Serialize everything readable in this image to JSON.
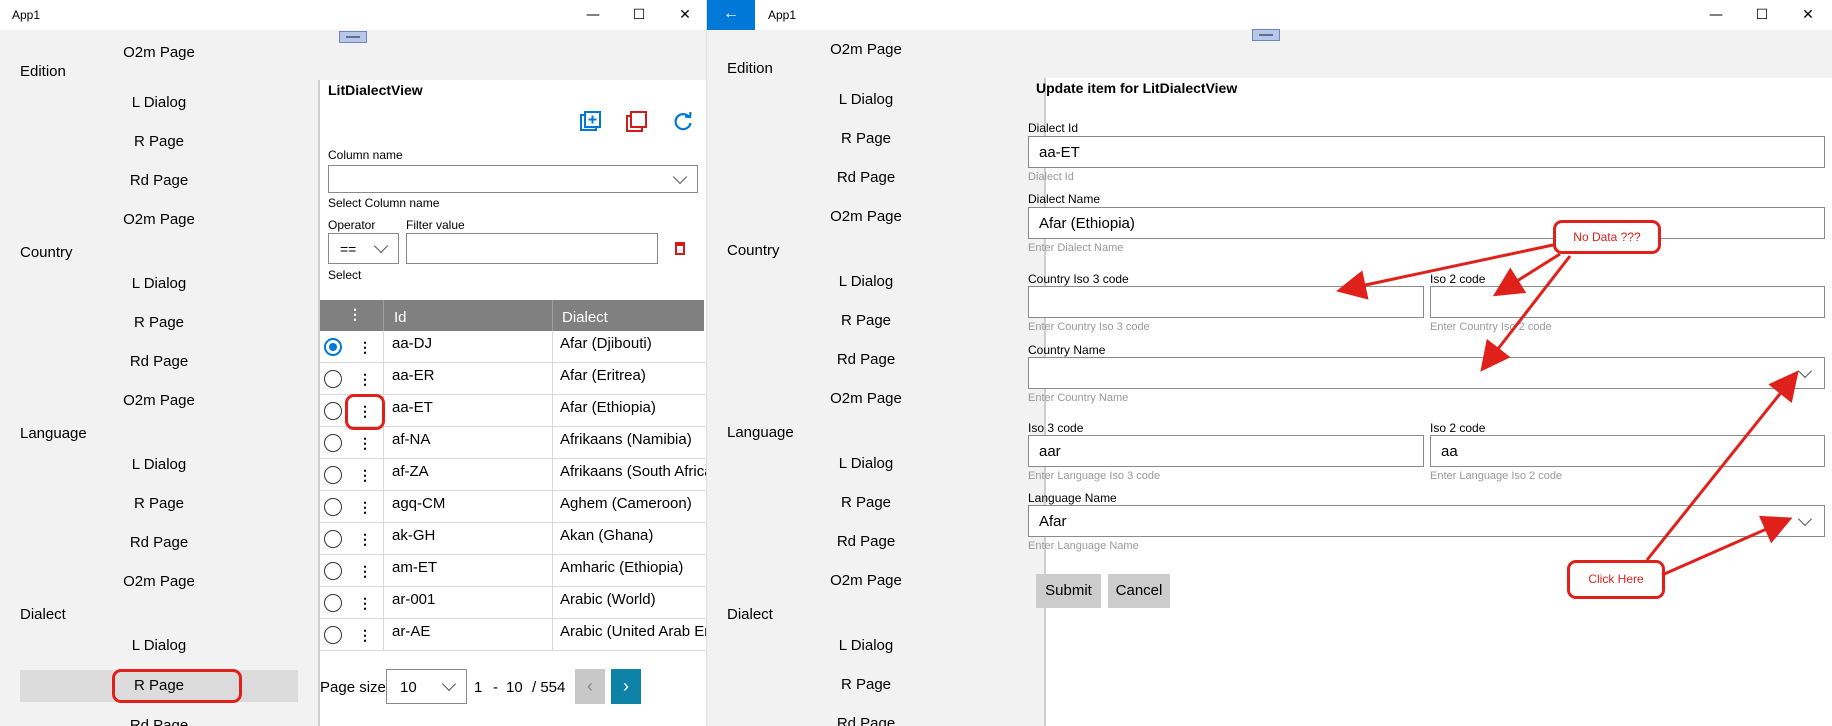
{
  "left_window": {
    "title": "App1",
    "controls": {
      "minimize": "—",
      "maximize": "☐",
      "close": "✕"
    },
    "nav": {
      "top_item": "O2m Page",
      "sections": [
        {
          "label": "Edition",
          "items": [
            "L Dialog",
            "R Page",
            "Rd Page",
            "O2m Page"
          ]
        },
        {
          "label": "Country",
          "items": [
            "L Dialog",
            "R Page",
            "Rd Page",
            "O2m Page"
          ]
        },
        {
          "label": "Language",
          "items": [
            "L Dialog",
            "R Page",
            "Rd Page",
            "O2m Page"
          ]
        },
        {
          "label": "Dialect",
          "items": [
            "L Dialog",
            "R Page",
            "Rd Page"
          ]
        }
      ],
      "selected": "Dialect / R Page"
    },
    "view": {
      "title": "LitDialectView",
      "toolbar_icons": [
        "add-item-icon",
        "copy-item-icon",
        "refresh-icon"
      ],
      "column_name_label": "Column name",
      "column_name_value": "",
      "column_name_hint": "Select Column name",
      "operator_label": "Operator",
      "operator_value": "==",
      "filter_label": "Filter value",
      "filter_value": "",
      "select_hint": "Select",
      "grid": {
        "headers": [
          "Id",
          "Dialect"
        ],
        "rows": [
          {
            "id": "aa-DJ",
            "dialect": "Afar (Djibouti)",
            "selected": true
          },
          {
            "id": "aa-ER",
            "dialect": "Afar (Eritrea)",
            "selected": false
          },
          {
            "id": "aa-ET",
            "dialect": "Afar (Ethiopia)",
            "selected": false
          },
          {
            "id": "af-NA",
            "dialect": "Afrikaans (Namibia)",
            "selected": false
          },
          {
            "id": "af-ZA",
            "dialect": "Afrikaans (South Africa)",
            "selected": false
          },
          {
            "id": "agq-CM",
            "dialect": "Aghem (Cameroon)",
            "selected": false
          },
          {
            "id": "ak-GH",
            "dialect": "Akan (Ghana)",
            "selected": false
          },
          {
            "id": "am-ET",
            "dialect": "Amharic (Ethiopia)",
            "selected": false
          },
          {
            "id": "ar-001",
            "dialect": "Arabic (World)",
            "selected": false
          },
          {
            "id": "ar-AE",
            "dialect": "Arabic (United Arab Emirates)",
            "selected": false
          }
        ]
      },
      "pager": {
        "size_label": "Page size",
        "size_value": "10",
        "from": "1",
        "dash": "-",
        "to": "10",
        "of": "/ 554",
        "prev": "‹",
        "next": "›"
      }
    }
  },
  "right_window": {
    "title": "App1",
    "back": "←",
    "controls": {
      "minimize": "—",
      "maximize": "☐",
      "close": "✕"
    },
    "nav": {
      "top_item": "O2m Page",
      "sections": [
        {
          "label": "Edition",
          "items": [
            "L Dialog",
            "R Page",
            "Rd Page",
            "O2m Page"
          ]
        },
        {
          "label": "Country",
          "items": [
            "L Dialog",
            "R Page",
            "Rd Page",
            "O2m Page"
          ]
        },
        {
          "label": "Language",
          "items": [
            "L Dialog",
            "R Page",
            "Rd Page",
            "O2m Page"
          ]
        },
        {
          "label": "Dialect",
          "items": [
            "L Dialog",
            "R Page",
            "Rd Page"
          ]
        }
      ]
    },
    "form": {
      "title": "Update item for LitDialectView",
      "dialect_id": {
        "label": "Dialect Id",
        "value": "aa-ET",
        "hint": "Dialect Id"
      },
      "dialect_name": {
        "label": "Dialect Name",
        "value": "Afar (Ethiopia)",
        "hint": "Enter Dialect Name"
      },
      "country_iso3": {
        "label": "Country Iso 3 code",
        "value": "",
        "hint": "Enter Country Iso 3 code"
      },
      "country_iso2": {
        "label": "Iso 2 code",
        "value": "",
        "hint": "Enter Country Iso 2 code"
      },
      "country_name": {
        "label": "Country Name",
        "value": "",
        "hint": "Enter Country Name"
      },
      "lang_iso3": {
        "label": "Iso 3 code",
        "value": "aar",
        "hint": "Enter Language Iso 3 code"
      },
      "lang_iso2": {
        "label": "Iso 2 code",
        "value": "aa",
        "hint": "Enter Language Iso 2 code"
      },
      "language_name": {
        "label": "Language Name",
        "value": "Afar",
        "hint": "Enter Language Name"
      },
      "submit": "Submit",
      "cancel": "Cancel"
    },
    "annotations": {
      "no_data": "No Data ???",
      "click_here": "Click Here"
    }
  },
  "colors": {
    "accent": "#0078d7",
    "annotation_red": "#e0201b",
    "grid_header": "#808080",
    "nav_bg": "#f2f2f2"
  }
}
